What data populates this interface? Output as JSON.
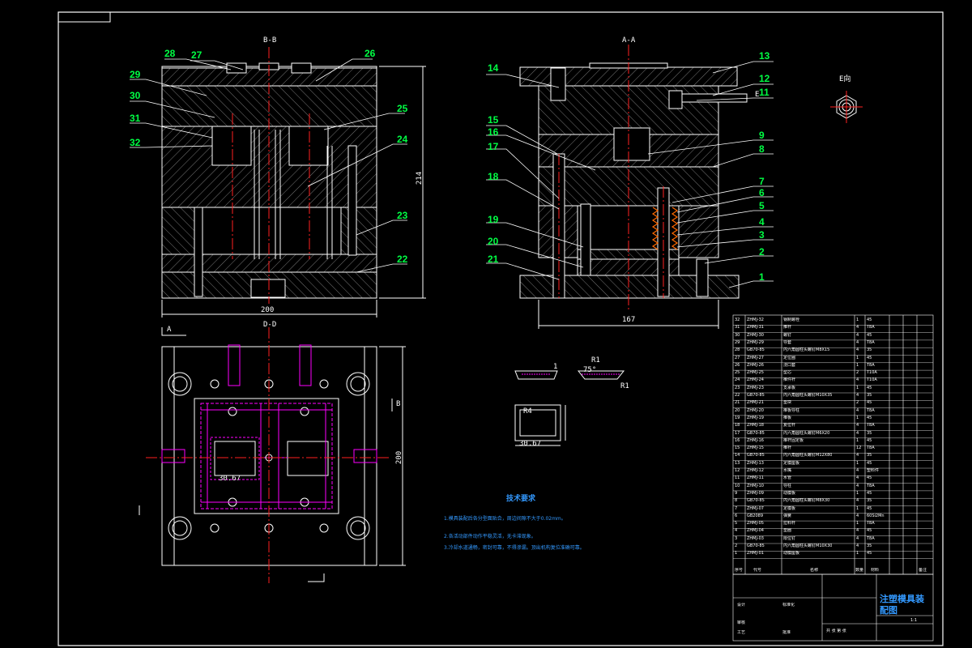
{
  "colors": {
    "background": "#000000",
    "frame": "#ffffff",
    "callout": "#00ff44",
    "centerline": "#ff2020",
    "hatch": "#808080",
    "tech_text": "#3399ff",
    "magenta": "#ff00ff"
  },
  "sections": {
    "left_title": "B-B",
    "right_title": "A-A",
    "bottom_title": "D-D",
    "direction_view": "E向"
  },
  "left_callouts": [
    "28",
    "27",
    "26",
    "29",
    "30",
    "25",
    "31",
    "32",
    "24",
    "23",
    "22"
  ],
  "right_callouts": [
    "14",
    "13",
    "12",
    "11",
    "15",
    "9",
    "16",
    "17",
    "8",
    "18",
    "7",
    "6",
    "5",
    "4",
    "19",
    "3",
    "20",
    "2",
    "21",
    "1"
  ],
  "dimensions": {
    "left_width": "200",
    "left_height": "214",
    "right_width": "167",
    "plan_height": "200",
    "detail_a": "30.67",
    "detail_b": "30.67",
    "detail_r4": "R4",
    "detail_r1a": "R1",
    "detail_r1b": "R1",
    "detail_angle": "75°",
    "detail_one": "1",
    "marker_a": "A",
    "marker_b": "B",
    "marker_e": "E"
  },
  "tech_requirements": {
    "title": "技术要求",
    "lines": [
      "1.模具装配后各分型面贴合，周边间隙不大于0.02mm。",
      "2.各活动部件动作平稳灵活，无卡滞现象。",
      "3.冷却水道通畅，密封可靠，不得渗漏。顶出机构复位准确可靠。"
    ]
  },
  "bom_rows": [
    [
      "32",
      "ZHMJ-32",
      "钢制螺栓",
      "1",
      "45"
    ],
    [
      "31",
      "ZHMJ-31",
      "推杆",
      "4",
      "T8A"
    ],
    [
      "30",
      "ZHMJ-30",
      "螺钉",
      "4",
      "45"
    ],
    [
      "29",
      "ZHMJ-29",
      "导套",
      "4",
      "T8A"
    ],
    [
      "28",
      "GB70-85",
      "内六角圆柱头螺钉M8X15",
      "4",
      "35"
    ],
    [
      "27",
      "ZHMJ-27",
      "定位圈",
      "1",
      "45"
    ],
    [
      "26",
      "ZHMJ-26",
      "浇口套",
      "1",
      "T8A"
    ],
    [
      "25",
      "ZHMJ-25",
      "型芯",
      "2",
      "T10A"
    ],
    [
      "24",
      "ZHMJ-24",
      "推件杆",
      "4",
      "T10A"
    ],
    [
      "23",
      "ZHMJ-23",
      "支承板",
      "1",
      "45"
    ],
    [
      "22",
      "GB70-85",
      "内六角圆柱头螺钉M10X35",
      "4",
      "35"
    ],
    [
      "21",
      "ZHMJ-21",
      "垫块",
      "2",
      "45"
    ],
    [
      "20",
      "ZHMJ-20",
      "推板导柱",
      "4",
      "T8A"
    ],
    [
      "19",
      "ZHMJ-19",
      "推板",
      "1",
      "45"
    ],
    [
      "18",
      "ZHMJ-18",
      "复位杆",
      "4",
      "T8A"
    ],
    [
      "17",
      "GB70-85",
      "内六角圆柱头螺钉M6X20",
      "4",
      "35"
    ],
    [
      "16",
      "ZHMJ-16",
      "推杆固定板",
      "1",
      "45"
    ],
    [
      "15",
      "ZHMJ-15",
      "推杆",
      "12",
      "T8A"
    ],
    [
      "14",
      "GB70-85",
      "内六角圆柱头螺钉M12X80",
      "4",
      "35"
    ],
    [
      "13",
      "ZHMJ-13",
      "定模座板",
      "1",
      "45"
    ],
    [
      "12",
      "ZHMJ-12",
      "水嘴",
      "4",
      "塑料件"
    ],
    [
      "11",
      "ZHMJ-11",
      "水管",
      "4",
      "45"
    ],
    [
      "10",
      "ZHMJ-10",
      "导柱",
      "4",
      "T8A"
    ],
    [
      "9",
      "ZHMJ-09",
      "动模板",
      "1",
      "45"
    ],
    [
      "8",
      "GB70-85",
      "内六角圆柱头螺钉M8X30",
      "4",
      "35"
    ],
    [
      "7",
      "ZHMJ-07",
      "定模板",
      "1",
      "45"
    ],
    [
      "6",
      "GB2089",
      "弹簧",
      "4",
      "60Si2Mn"
    ],
    [
      "5",
      "ZHMJ-05",
      "拉料杆",
      "1",
      "T8A"
    ],
    [
      "4",
      "ZHMJ-04",
      "垫圈",
      "4",
      "45"
    ],
    [
      "3",
      "ZHMJ-03",
      "限位钉",
      "4",
      "T8A"
    ],
    [
      "2",
      "GB70-85",
      "内六角圆柱头螺钉M10X30",
      "4",
      "35"
    ],
    [
      "1",
      "ZHMJ-01",
      "动模座板",
      "1",
      "45"
    ]
  ],
  "bom_header": [
    "序号",
    "代号",
    "名称",
    "数量",
    "材料",
    "备注"
  ],
  "title_block": {
    "title": "注塑模具装配图",
    "scale": "1:1",
    "sheets": "共 张 第 张",
    "design": "设计",
    "check": "审核",
    "process": "工艺",
    "std": "标准化",
    "approve": "批准"
  }
}
